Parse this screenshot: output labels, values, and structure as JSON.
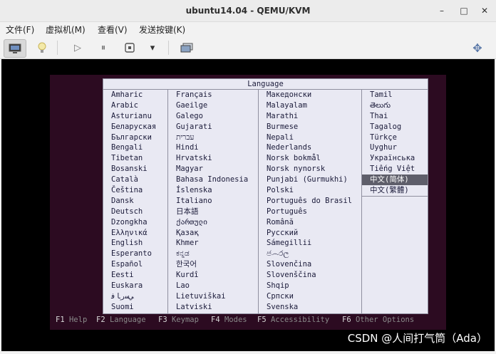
{
  "window": {
    "title": "ubuntu14.04 - QEMU/KVM",
    "min_glyph": "–",
    "max_glyph": "□",
    "close_glyph": "✕"
  },
  "menubar": [
    "文件(F)",
    "虚拟机(M)",
    "查看(V)",
    "发送按键(K)"
  ],
  "toolbar": {
    "icons": [
      "monitor-icon",
      "lightbulb-icon",
      "play-icon",
      "pause-icon",
      "stop-icon",
      "chevron-down-icon",
      "screenshot-icon",
      "move-icon"
    ],
    "glyphs": {
      "play": "▷",
      "pause": "⏸",
      "chevron": "▾",
      "move": "✥"
    }
  },
  "installer": {
    "box_title": "Language",
    "columns": [
      [
        "Amharic",
        "Arabic",
        "Asturianu",
        "Беларуская",
        "Български",
        "Bengali",
        "Tibetan",
        "Bosanski",
        "Català",
        "Čeština",
        "Dansk",
        "Deutsch",
        "Dzongkha",
        "Ελληνικά",
        "English",
        "Esperanto",
        "Español",
        "Eesti",
        "Euskara",
        "ﻲﺳﺭﺎﻓ",
        "Suomi"
      ],
      [
        "Français",
        "Gaeilge",
        "Galego",
        "Gujarati",
        "עברית",
        "Hindi",
        "Hrvatski",
        "Magyar",
        "Bahasa Indonesia",
        "Íslenska",
        "Italiano",
        "日本語",
        "ქართული",
        "Қазақ",
        "Khmer",
        "ಕನ್ನಡ",
        "한국어",
        "Kurdî",
        "Lao",
        "Lietuviškai",
        "Latviski"
      ],
      [
        "Македонски",
        "Malayalam",
        "Marathi",
        "Burmese",
        "Nepali",
        "Nederlands",
        "Norsk bokmål",
        "Norsk nynorsk",
        "Punjabi (Gurmukhi)",
        "Polski",
        "Português do Brasil",
        "Português",
        "Română",
        "Русский",
        "Sámegillii",
        "ජ෴෮ල",
        "Slovenčina",
        "Slovenščina",
        "Shqip",
        "Српски",
        "Svenska"
      ],
      [
        "Tamil",
        "తెలుగు",
        "Thai",
        "Tagalog",
        "Türkçe",
        "Uyghur",
        "Українська",
        "Tiếng Việt",
        "中文(简体)",
        "中文(繁體)"
      ]
    ],
    "selected": "中文(简体)",
    "fkeys": [
      {
        "key": "F1",
        "label": "Help"
      },
      {
        "key": "F2",
        "label": "Language"
      },
      {
        "key": "F3",
        "label": "Keymap"
      },
      {
        "key": "F4",
        "label": "Modes"
      },
      {
        "key": "F5",
        "label": "Accessibility"
      },
      {
        "key": "F6",
        "label": "Other Options"
      }
    ]
  },
  "watermark": "CSDN @人间打气筒（Ada）",
  "colors": {
    "installer_bg": "#2c0b21",
    "list_bg": "#e9e9f3",
    "selected_bg": "#5e5e6a"
  }
}
